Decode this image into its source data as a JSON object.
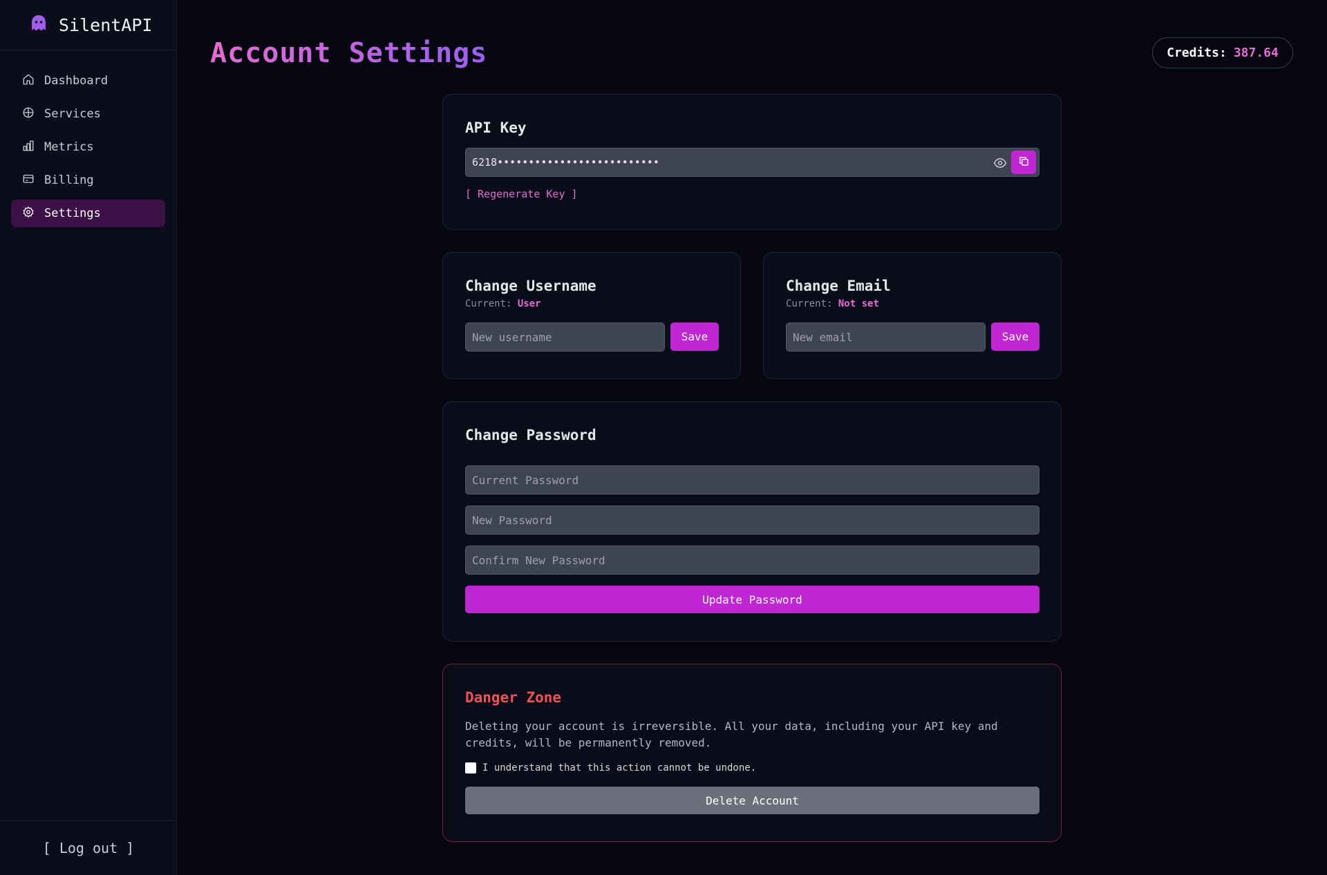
{
  "app": {
    "name": "SilentAPI",
    "logo_icon": "ghost-icon"
  },
  "sidebar": {
    "items": [
      {
        "label": "Dashboard",
        "icon": "home-icon",
        "active": false
      },
      {
        "label": "Services",
        "icon": "globe-icon",
        "active": false
      },
      {
        "label": "Metrics",
        "icon": "bar-chart-icon",
        "active": false
      },
      {
        "label": "Billing",
        "icon": "credit-card-icon",
        "active": false
      },
      {
        "label": "Settings",
        "icon": "gear-icon",
        "active": true
      }
    ],
    "logout_label": "[ Log out ]"
  },
  "header": {
    "title": "Account Settings",
    "credits_label": "Credits:",
    "credits_value": "387.64"
  },
  "api_key": {
    "title": "API Key",
    "masked_value": "6218••••••••••••••••••••••••••",
    "regenerate_label": "[ Regenerate Key ]"
  },
  "username": {
    "title": "Change Username",
    "current_label": "Current:",
    "current_value": "User",
    "placeholder": "New username",
    "save_label": "Save"
  },
  "email": {
    "title": "Change Email",
    "current_label": "Current:",
    "current_value": "Not set",
    "placeholder": "New email",
    "save_label": "Save"
  },
  "password": {
    "title": "Change Password",
    "current_placeholder": "Current Password",
    "new_placeholder": "New Password",
    "confirm_placeholder": "Confirm New Password",
    "update_label": "Update Password"
  },
  "danger": {
    "title": "Danger Zone",
    "description": "Deleting your account is irreversible. All your data, including your API key and credits, will be permanently removed.",
    "confirm_label": "I understand that this action cannot be undone.",
    "delete_label": "Delete Account"
  },
  "colors": {
    "accent": "#c026d3",
    "title_gradient_start": "#e66bd4",
    "title_gradient_end": "#9a5ef0",
    "danger": "#f05252",
    "background": "#05060f"
  }
}
